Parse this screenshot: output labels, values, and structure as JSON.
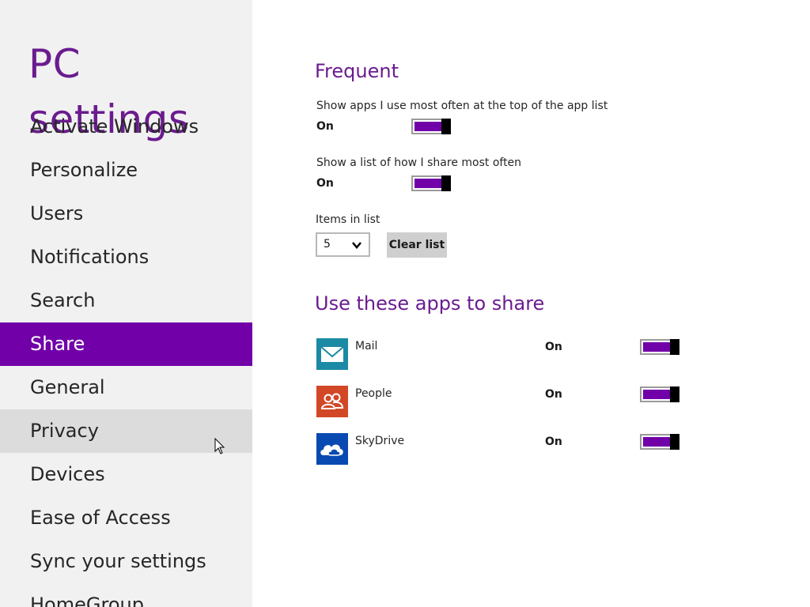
{
  "window": {
    "title": "PC settings"
  },
  "sidebar": {
    "items": [
      {
        "label": "Activate Windows",
        "state": "normal"
      },
      {
        "label": "Personalize",
        "state": "normal"
      },
      {
        "label": "Users",
        "state": "normal"
      },
      {
        "label": "Notifications",
        "state": "normal"
      },
      {
        "label": "Search",
        "state": "normal"
      },
      {
        "label": "Share",
        "state": "selected"
      },
      {
        "label": "General",
        "state": "normal"
      },
      {
        "label": "Privacy",
        "state": "hover"
      },
      {
        "label": "Devices",
        "state": "normal"
      },
      {
        "label": "Ease of Access",
        "state": "normal"
      },
      {
        "label": "Sync your settings",
        "state": "normal"
      },
      {
        "label": "HomeGroup",
        "state": "normal"
      }
    ]
  },
  "frequent": {
    "title": "Frequent",
    "show_top_apps": {
      "label": "Show apps I use most often at the top of the app list",
      "state": "On"
    },
    "show_share_list": {
      "label": "Show a list of how I share most often",
      "state": "On"
    },
    "items_in_list": {
      "label": "Items in list",
      "value": "5"
    },
    "clear_button": "Clear list"
  },
  "share_apps": {
    "title": "Use these apps to share",
    "apps": [
      {
        "name": "Mail",
        "state": "On",
        "icon": "mail-icon",
        "color": "#1b8aa5"
      },
      {
        "name": "People",
        "state": "On",
        "icon": "people-icon",
        "color": "#d24726"
      },
      {
        "name": "SkyDrive",
        "state": "On",
        "icon": "skydrive-icon",
        "color": "#094ab2"
      }
    ]
  },
  "colors": {
    "accent": "#7100a8",
    "title": "#6b1b8f",
    "sidebar_bg": "#f1f1f1",
    "hover_bg": "#dcdcdc"
  }
}
